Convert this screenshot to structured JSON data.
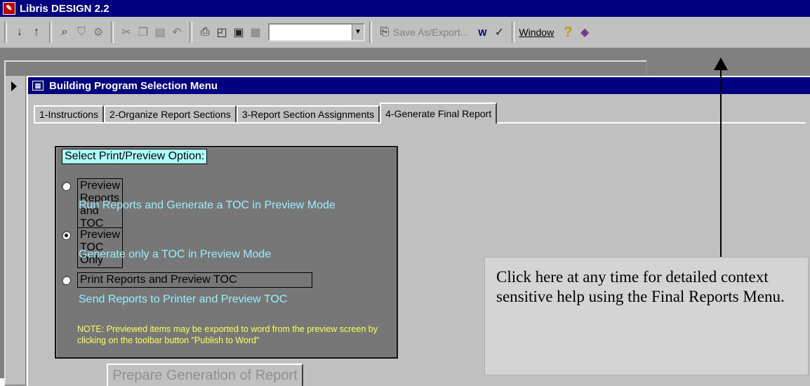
{
  "app": {
    "title": "Libris DESIGN 2.2"
  },
  "toolbar": {
    "save_as_label": "Save As/Export...",
    "window_label": "Window",
    "combo_value": ""
  },
  "dialog": {
    "title": "Building Program Selection Menu",
    "tabs": [
      {
        "label": "1-Instructions"
      },
      {
        "label": "2-Organize Report Sections"
      },
      {
        "label": "3-Report Section Assignments"
      },
      {
        "label": "4-Generate Final Report"
      }
    ],
    "active_tab": "4-Generate Final Report"
  },
  "print_options": {
    "heading": "Select Print/Preview Option:",
    "options": [
      {
        "label": "Preview Reports and TOC",
        "description": "Run Reports and Generate a TOC in Preview Mode",
        "selected": false
      },
      {
        "label": "Preview TOC Only",
        "description": "Generate only a TOC in Preview Mode",
        "selected": true
      },
      {
        "label": "Print Reports and  Preview TOC",
        "description": "Send Reports to Printer and Preview TOC",
        "selected": false
      }
    ],
    "note": "NOTE: Previewed items may be exported to word from the preview screen by clicking on the toolbar button \"Publish to Word\""
  },
  "generate_button": {
    "label": "Prepare Generation of Report"
  },
  "callout": {
    "text": "Click here at any time for detailed context sensitive help using the Final Reports Menu."
  },
  "colors": {
    "titlebar": "#000080",
    "panel": "#777777",
    "heading_bg": "#aaffff",
    "description_text": "#99eeff",
    "note_text": "#ffff55"
  }
}
